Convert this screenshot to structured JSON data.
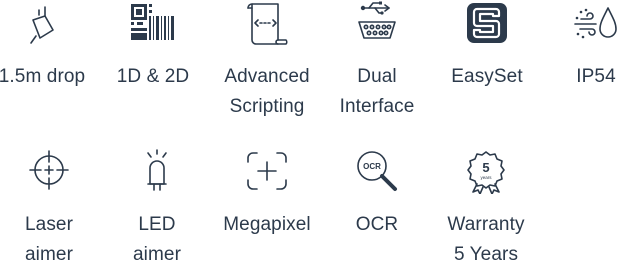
{
  "accent_color": "#2c3a4b",
  "features_row1": [
    {
      "icon": "drop-icon",
      "lines": [
        "1.5m drop"
      ]
    },
    {
      "icon": "barcode-qr-icon",
      "lines": [
        "1D & 2D"
      ]
    },
    {
      "icon": "scroll-script-icon",
      "lines": [
        "Advanced",
        "Scripting"
      ]
    },
    {
      "icon": "usb-serial-icon",
      "lines": [
        "Dual",
        "Interface"
      ]
    },
    {
      "icon": "easyset-logo-icon",
      "lines": [
        "EasySet"
      ]
    },
    {
      "icon": "dust-water-icon",
      "lines": [
        "IP54"
      ]
    }
  ],
  "features_row2": [
    {
      "icon": "crosshair-icon",
      "lines": [
        "Laser",
        "aimer"
      ]
    },
    {
      "icon": "led-icon",
      "lines": [
        "LED",
        "aimer"
      ]
    },
    {
      "icon": "megapixel-frame-icon",
      "lines": [
        "Megapixel"
      ]
    },
    {
      "icon": "ocr-magnifier-icon",
      "lines": [
        "OCR"
      ]
    },
    {
      "icon": "warranty-badge-icon",
      "lines": [
        "Warranty",
        "5 Years"
      ],
      "badge_number": "5",
      "badge_word": "years"
    }
  ]
}
